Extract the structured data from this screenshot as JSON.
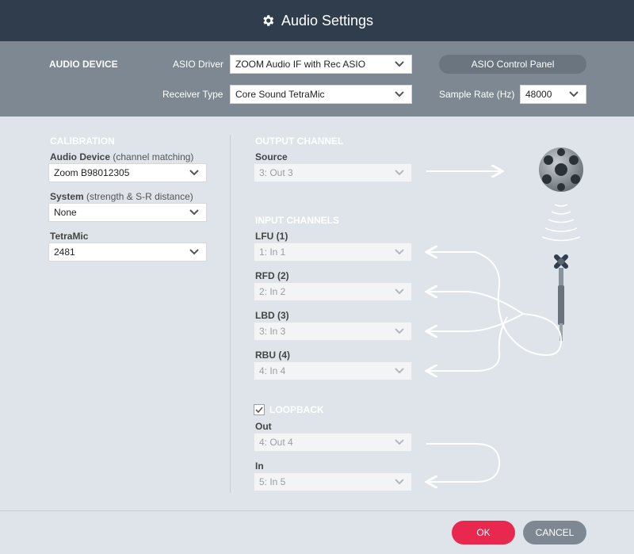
{
  "window": {
    "title": "Audio Settings",
    "icon": "gear-icon"
  },
  "device_bar": {
    "section": "AUDIO DEVICE",
    "asio_driver_label": "ASIO Driver",
    "asio_driver_value": "ZOOM Audio IF with Rec ASIO",
    "asio_control_panel": "ASIO Control Panel",
    "receiver_type_label": "Receiver Type",
    "receiver_type_value": "Core Sound TetraMic",
    "sample_rate_label": "Sample Rate (Hz)",
    "sample_rate_value": "48000"
  },
  "calibration": {
    "section": "CALIBRATION",
    "audio_device_label": "Audio Device",
    "audio_device_sub": "(channel matching)",
    "audio_device_value": "Zoom B98012305",
    "system_label": "System",
    "system_sub": "(strength & S-R distance)",
    "system_value": "None",
    "tetramic_label": "TetraMic",
    "tetramic_value": "2481"
  },
  "output": {
    "section": "OUTPUT CHANNEL",
    "source_label": "Source",
    "source_value": "3: Out 3"
  },
  "inputs": {
    "section": "INPUT CHANNELS",
    "channels": [
      {
        "label": "LFU (1)",
        "value": "1: In 1"
      },
      {
        "label": "RFD (2)",
        "value": "2: In 2"
      },
      {
        "label": "LBD (3)",
        "value": "3: In 3"
      },
      {
        "label": "RBU (4)",
        "value": "4: In 4"
      }
    ]
  },
  "loopback": {
    "checked": true,
    "label": "LOOPBACK",
    "out_label": "Out",
    "out_value": "4: Out 4",
    "in_label": "In",
    "in_value": "5: In 5"
  },
  "footer": {
    "ok": "OK",
    "cancel": "CANCEL"
  },
  "colors": {
    "header": "#2f3d4d",
    "device_bar": "#7d8892",
    "body": "#dfe4ea",
    "ok": "#e8284f",
    "cancel": "#7d8892"
  }
}
